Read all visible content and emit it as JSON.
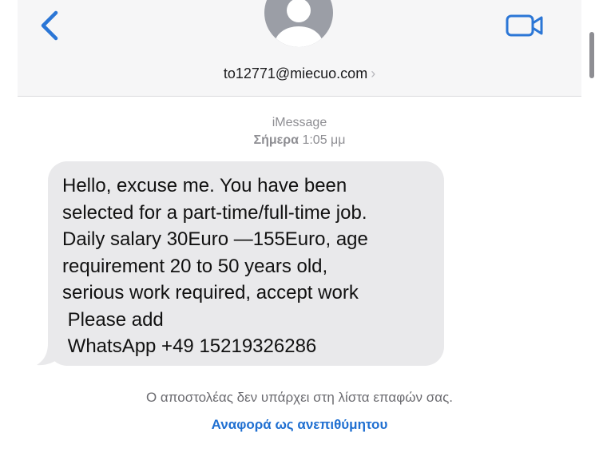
{
  "header": {
    "contact_label": "to12771@miecuo.com",
    "chevron": "›",
    "back_icon": "chevron-left-icon",
    "video_icon": "video-camera-icon"
  },
  "conversation": {
    "service": "iMessage",
    "day": "Σήμερα",
    "time": "1:05 μμ"
  },
  "message": {
    "text": "Hello, excuse me. You have been\nselected for a part-time/full-time job.\nDaily salary 30Euro —155Euro, age\nrequirement 20 to 50 years old,\nserious work required, accept work\n Please add\n WhatsApp +49 15219326286"
  },
  "footer": {
    "notice": "Ο αποστολέας δεν υπάρχει στη λίστα επαφών σας.",
    "report_link": "Αναφορά ως ανεπιθύμητου"
  },
  "colors": {
    "accent": "#2b76d6",
    "bubble": "#e9e9eb",
    "header_bg": "#f6f6f7"
  }
}
